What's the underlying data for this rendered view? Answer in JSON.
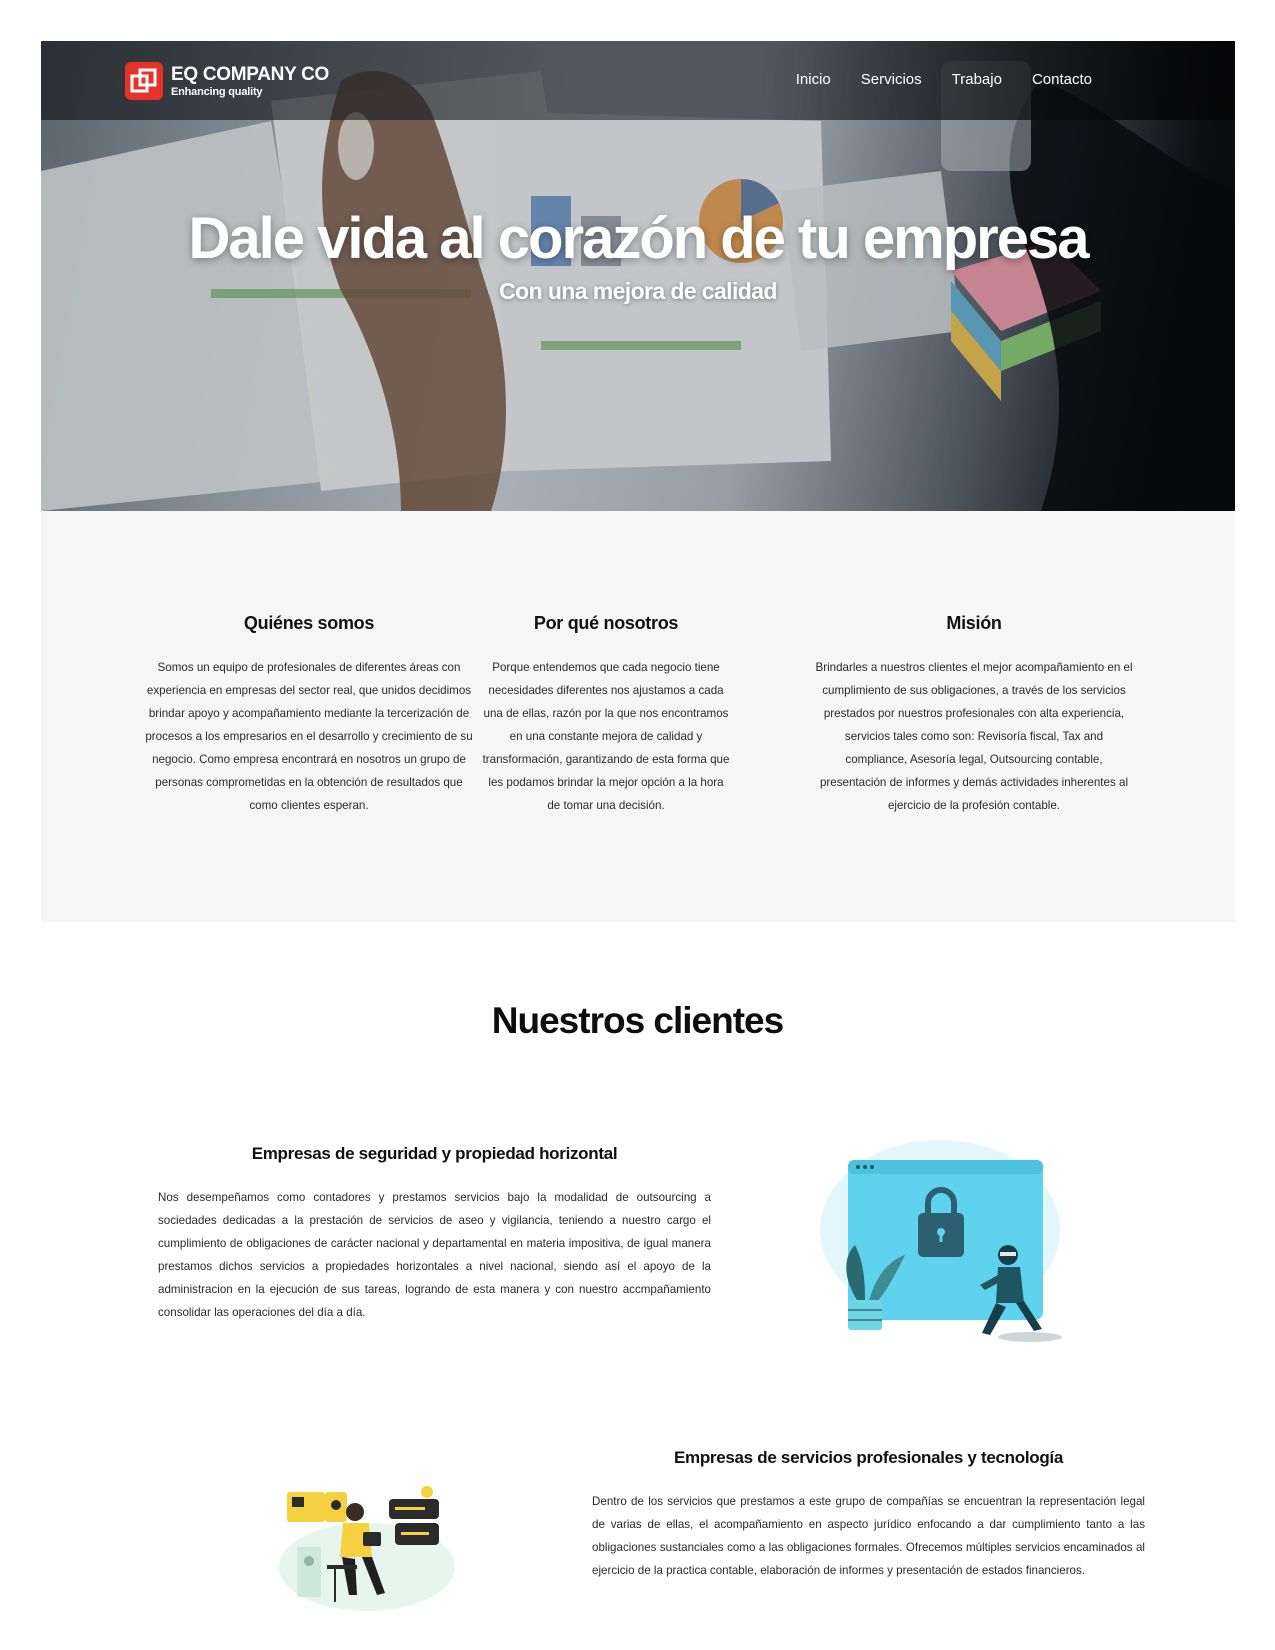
{
  "brand": {
    "name": "EQ COMPANY CO",
    "tagline": "Enhancing quality",
    "accent": "#e6332a"
  },
  "nav": {
    "items": [
      "Inicio",
      "Servicios",
      "Trabajo",
      "Contacto"
    ]
  },
  "hero": {
    "title": "Dale vida al corazón de tu empresa",
    "subtitle": "Con una mejora de calidad"
  },
  "features": [
    {
      "title": "Quiénes somos",
      "text": "Somos un equipo de profesionales de diferentes áreas con experiencia en empresas del sector real, que unidos decidimos brindar apoyo y acompañamiento mediante la tercerización de procesos a los empresarios en el desarrollo y crecimiento de su negocio. Como empresa encontrará en nosotros un grupo de personas comprometidas en la obtención de resultados que como clientes esperan."
    },
    {
      "title": "Por qué nosotros",
      "text": "Porque entendemos que cada negocio tiene necesidades diferentes nos ajustamos a cada una de ellas, razón por la que nos encontramos en una constante mejora de calidad y transformación, garantizando de esta forma que les podamos brindar la mejor opción a la hora de tomar una decisión."
    },
    {
      "title": "Misión",
      "text": "Brindarles a nuestros clientes el mejor acompañamiento en el cumplimiento de sus obligaciones, a través de los servicios prestados por nuestros profesionales con alta experiencia, servicios tales como son: Revisoría fiscal, Tax and compliance, Asesoría legal, Outsourcing contable, presentación de informes y demás actividades inherentes al ejercicio de la profesión contable."
    }
  ],
  "clients": {
    "title": "Nuestros clientes",
    "items": [
      {
        "title": "Empresas de seguridad y propiedad horizontal",
        "text": "Nos desempeñamos como contadores y prestamos servicios bajo la modalidad de outsourcing a sociedades dedicadas a la prestación de servicios de aseo y vigilancia, teniendo a nuestro cargo el cumplimiento de obligaciones de carácter nacional y departamental en materia impositiva, de igual manera prestamos dichos servicios a propiedades horizontales a nivel nacional, siendo así el apoyo de la administracion en la ejecución de sus tareas, logrando de esta manera y con nuestro accmpañamiento consolidar las operaciones del día a día."
      },
      {
        "title": "Empresas de servicios profesionales y tecnología",
        "text": "Dentro de los servicios que prestamos a este grupo de compañías se encuentran la representación legal de varias de ellas, el acompañamiento en aspecto jurídico enfocando a dar cumplimiento tanto a las obligaciones sustanciales como a las obligaciones formales. Ofrecemos múltiples servicios encaminados al ejercicio de la practica contable, elaboración de informes y presentación de estados financieros."
      }
    ]
  }
}
